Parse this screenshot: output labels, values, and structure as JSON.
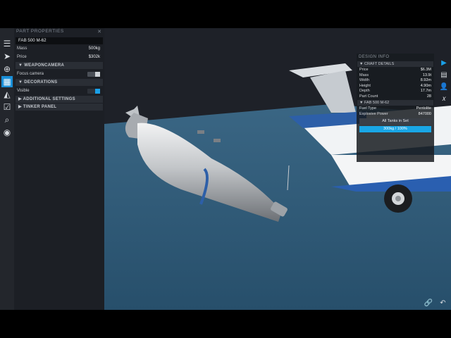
{
  "part_properties": {
    "header": "PART PROPERTIES",
    "part_name": "FAB 500 M-62",
    "mass_label": "Mass",
    "mass_value": "500kg",
    "price_label": "Price",
    "price_value": "$302k",
    "weapon_camera_section": "WEAPONCAMERA",
    "focus_camera_label": "Focus camera",
    "decorations_section": "DECORATIONS",
    "visible_label": "Visible",
    "additional_settings_section": "ADDITIONAL SETTINGS",
    "tinker_panel_section": "TINKER PANEL"
  },
  "design_info": {
    "header": "DESIGN INFO",
    "craft_details_section": "CRAFT DETAILS",
    "rows": [
      {
        "label": "Price",
        "value": "$6.3M"
      },
      {
        "label": "Mass",
        "value": "13.9t"
      },
      {
        "label": "Width",
        "value": "8.92m"
      },
      {
        "label": "Height",
        "value": "4.90m"
      },
      {
        "label": "Depth",
        "value": "17.7m"
      },
      {
        "label": "Part Count",
        "value": "28"
      }
    ],
    "part_section": "FAB 500 M-62",
    "fuel_type_label": "Fuel Type",
    "fuel_type_value": "Pentolite",
    "explosive_power_label": "Explosive Power",
    "explosive_power_value": "847000",
    "all_tanks_button": "All Tanks in Set",
    "fuel_bar_label": "300kg / 100%",
    "fuel_fill": 1.0
  },
  "colors": {
    "accent": "#1aa0e8",
    "ground": "#2c5877",
    "panel_bg": "#1c1f24"
  },
  "icons": {
    "menu": "menu-icon",
    "select": "cursor-icon",
    "add_part": "add-part-icon",
    "grid": "grid-icon",
    "symmetry": "symmetry-icon",
    "checklist": "checklist-icon",
    "search": "search-icon",
    "view": "eye-icon",
    "play": "play-icon",
    "list": "list-icon",
    "person": "person-icon",
    "fx": "fx-icon",
    "link": "link-icon",
    "undo": "undo-icon"
  }
}
